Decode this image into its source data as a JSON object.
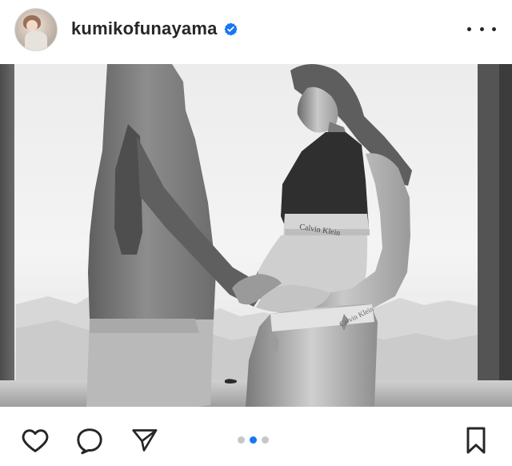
{
  "post": {
    "username": "kumikofunayama",
    "verified": true
  },
  "icons": {
    "avatar": "profile-avatar",
    "verified": "verified-badge-icon",
    "more": "more-options-icon",
    "like": "heart-icon",
    "comment": "comment-icon",
    "share": "paper-plane-icon",
    "save": "bookmark-icon"
  },
  "carousel": {
    "total": 3,
    "active_index": 1
  },
  "photo": {
    "underwear_text": "Calvin Klein"
  },
  "colors": {
    "accent": "#1877f2",
    "text": "#262626",
    "indicator_inactive": "#c7c7c7"
  }
}
